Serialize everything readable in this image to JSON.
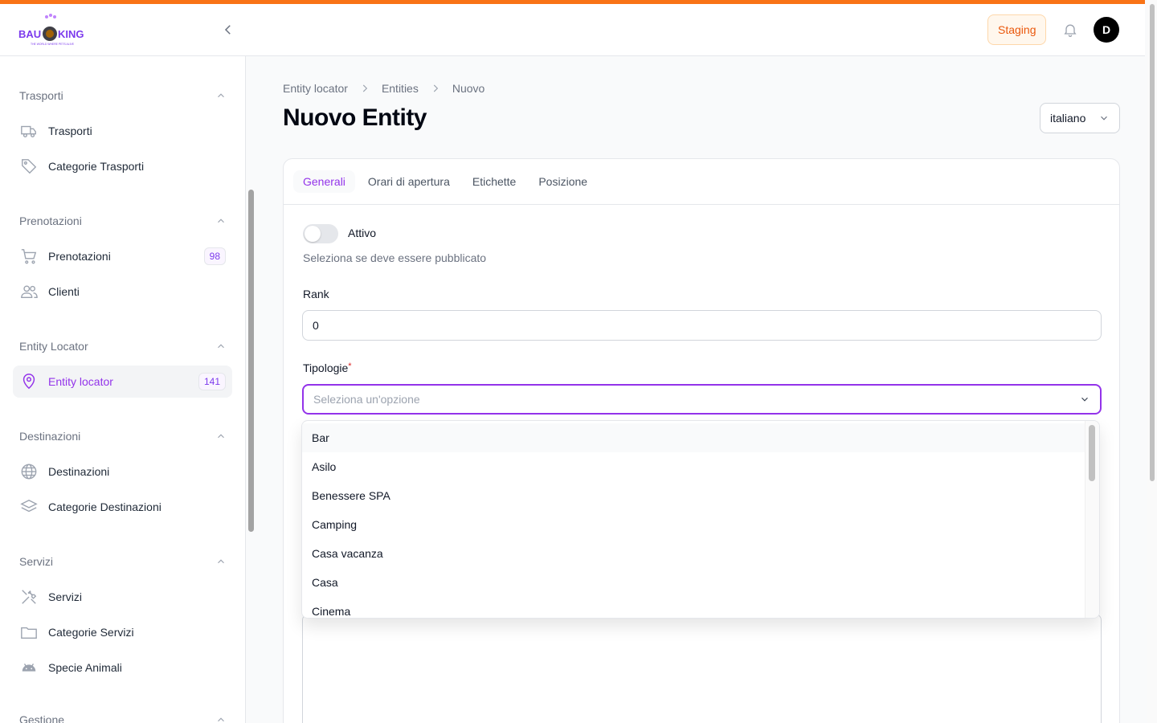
{
  "header": {
    "logo_text": "BAU KING",
    "logo_tagline": "THE WORLD WHERE PETS ALIVE",
    "staging_label": "Staging",
    "avatar_initial": "D"
  },
  "sidebar": {
    "groups": [
      {
        "title": "Trasporti",
        "items": [
          {
            "label": "Trasporti",
            "icon": "truck-icon"
          },
          {
            "label": "Categorie Trasporti",
            "icon": "tag-icon"
          }
        ]
      },
      {
        "title": "Prenotazioni",
        "items": [
          {
            "label": "Prenotazioni",
            "icon": "cart-icon",
            "badge": "98"
          },
          {
            "label": "Clienti",
            "icon": "users-icon"
          }
        ]
      },
      {
        "title": "Entity Locator",
        "items": [
          {
            "label": "Entity locator",
            "icon": "map-pin-icon",
            "badge": "141",
            "active": true
          }
        ]
      },
      {
        "title": "Destinazioni",
        "items": [
          {
            "label": "Destinazioni",
            "icon": "globe-icon"
          },
          {
            "label": "Categorie Destinazioni",
            "icon": "layers-icon"
          }
        ]
      },
      {
        "title": "Servizi",
        "items": [
          {
            "label": "Servizi",
            "icon": "tools-icon"
          },
          {
            "label": "Categorie Servizi",
            "icon": "folder-icon"
          },
          {
            "label": "Specie Animali",
            "icon": "android-icon"
          }
        ]
      },
      {
        "title": "Gestione",
        "items": []
      }
    ]
  },
  "breadcrumb": [
    "Entity locator",
    "Entities",
    "Nuovo"
  ],
  "page_title": "Nuovo Entity",
  "language": {
    "selected": "italiano"
  },
  "tabs": [
    "Generali",
    "Orari di apertura",
    "Etichette",
    "Posizione"
  ],
  "form": {
    "active_label": "Attivo",
    "active_help": "Seleziona se deve essere pubblicato",
    "rank_label": "Rank",
    "rank_value": "0",
    "tipologie_label": "Tipologie",
    "tipologie_required": "*",
    "tipologie_placeholder": "Seleziona un'opzione"
  },
  "dropdown_options": [
    "Bar",
    "Asilo",
    "Benessere SPA",
    "Camping",
    "Casa vacanza",
    "Casa",
    "Cinema"
  ],
  "colors": {
    "accent": "#9333ea",
    "brand_orange": "#f97316"
  }
}
